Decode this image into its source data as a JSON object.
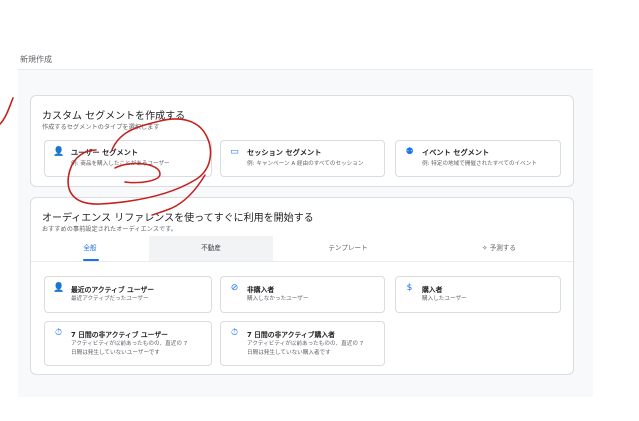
{
  "topbar": {
    "title": "新規作成"
  },
  "custom": {
    "title": "カスタム セグメントを作成する",
    "subtitle": "作成するセグメントのタイプを選択します",
    "segments": [
      {
        "icon": "person-icon",
        "glyph": "👤",
        "title": "ユーザー セグメント",
        "desc": "例: 商品を購入したことがあるユーザー"
      },
      {
        "icon": "session-icon",
        "glyph": "▭",
        "title": "セッション セグメント",
        "desc": "例: キャンペーン A 経由のすべてのセッション"
      },
      {
        "icon": "event-icon",
        "glyph": "⚉",
        "title": "イベント セグメント",
        "desc": "例: 特定の地域で開催されたすべてのイベント"
      }
    ]
  },
  "audience": {
    "title": "オーディエンス リファレンスを使ってすぐに利用を開始する",
    "subtitle": "おすすめの事前設定されたオーディエンスです。",
    "tabs": [
      {
        "label": "全般",
        "icon": ""
      },
      {
        "label": "不動産",
        "icon": ""
      },
      {
        "label": "テンプレート",
        "icon": ""
      },
      {
        "label": "予測する",
        "icon": "✧"
      }
    ],
    "items": [
      {
        "icon": "person-icon",
        "glyph": "👤",
        "title": "最近のアクティブ ユーザー",
        "desc": "最近アクティブだったユーザー"
      },
      {
        "icon": "no-purchase-icon",
        "glyph": "⊘",
        "title": "非購入者",
        "desc": "購入しなかったユーザー"
      },
      {
        "icon": "dollar-icon",
        "glyph": "$",
        "title": "購入者",
        "desc": "購入したユーザー"
      },
      {
        "icon": "timer-icon",
        "glyph": "⏱",
        "title": "7 日間の非アクティブ ユーザー",
        "desc": "アクティビティが以前あったものの、直近の 7",
        "desc2": "日間は発生していないユーザーです"
      },
      {
        "icon": "timer-icon",
        "glyph": "⏱",
        "title": "7 日間の非アクティブ購入者",
        "desc": "アクティビティが以前あったものの、直近の 7",
        "desc2": "日間は発生していない購入者です"
      }
    ]
  },
  "colors": {
    "accent": "#1a73e8",
    "annotation": "#c5221f"
  }
}
